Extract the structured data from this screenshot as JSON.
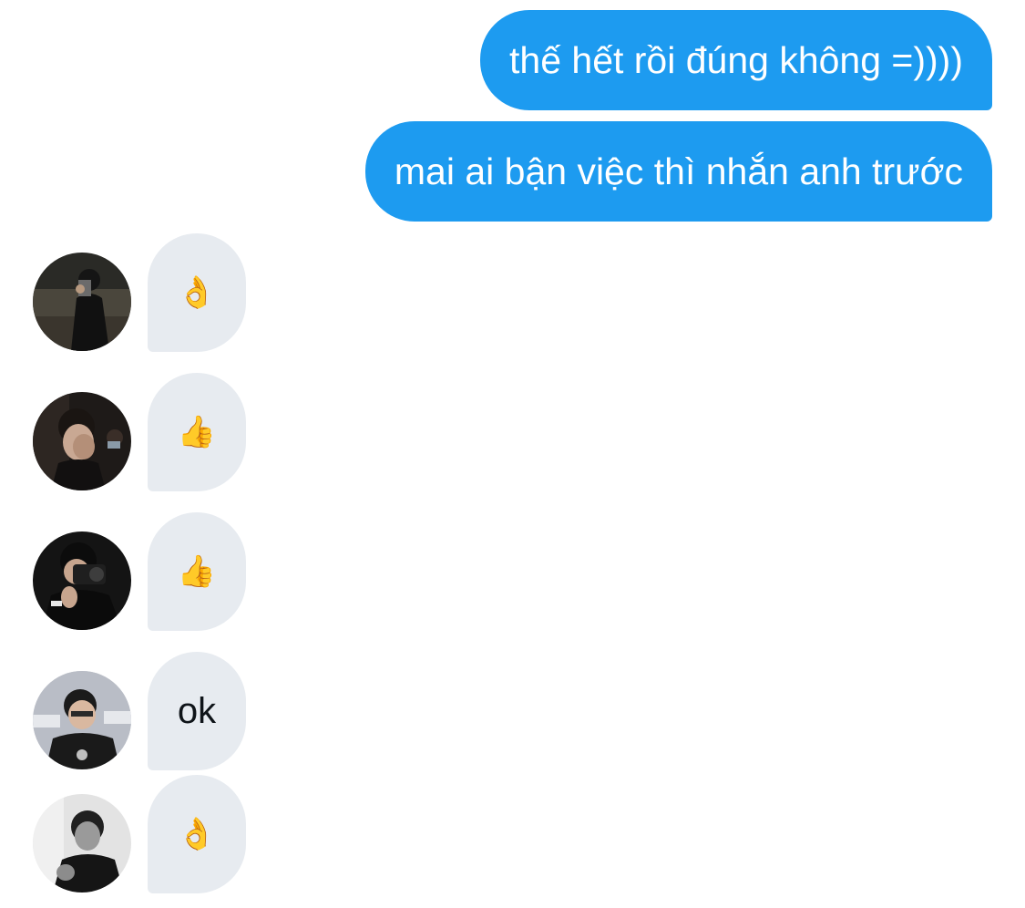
{
  "conversation": {
    "outgoing": [
      {
        "text": "thế hết rồi đúng không =))))"
      },
      {
        "text": "mai ai bận việc thì nhắn anh trước"
      }
    ],
    "incoming": [
      {
        "content": "👌",
        "kind": "emoji",
        "avatar_theme": "night-mirror-selfie"
      },
      {
        "content": "👍",
        "kind": "emoji",
        "avatar_theme": "hand-over-face"
      },
      {
        "content": "👍",
        "kind": "emoji",
        "avatar_theme": "camera-holder"
      },
      {
        "content": "ok",
        "kind": "text",
        "avatar_theme": "event-backdrop"
      },
      {
        "content": "👌",
        "kind": "emoji",
        "avatar_theme": "monochrome-portrait"
      }
    ]
  },
  "colors": {
    "outgoing_bubble": "#1d9bf0",
    "incoming_bubble": "#e7ebf0",
    "text_dark": "#0f1419"
  }
}
